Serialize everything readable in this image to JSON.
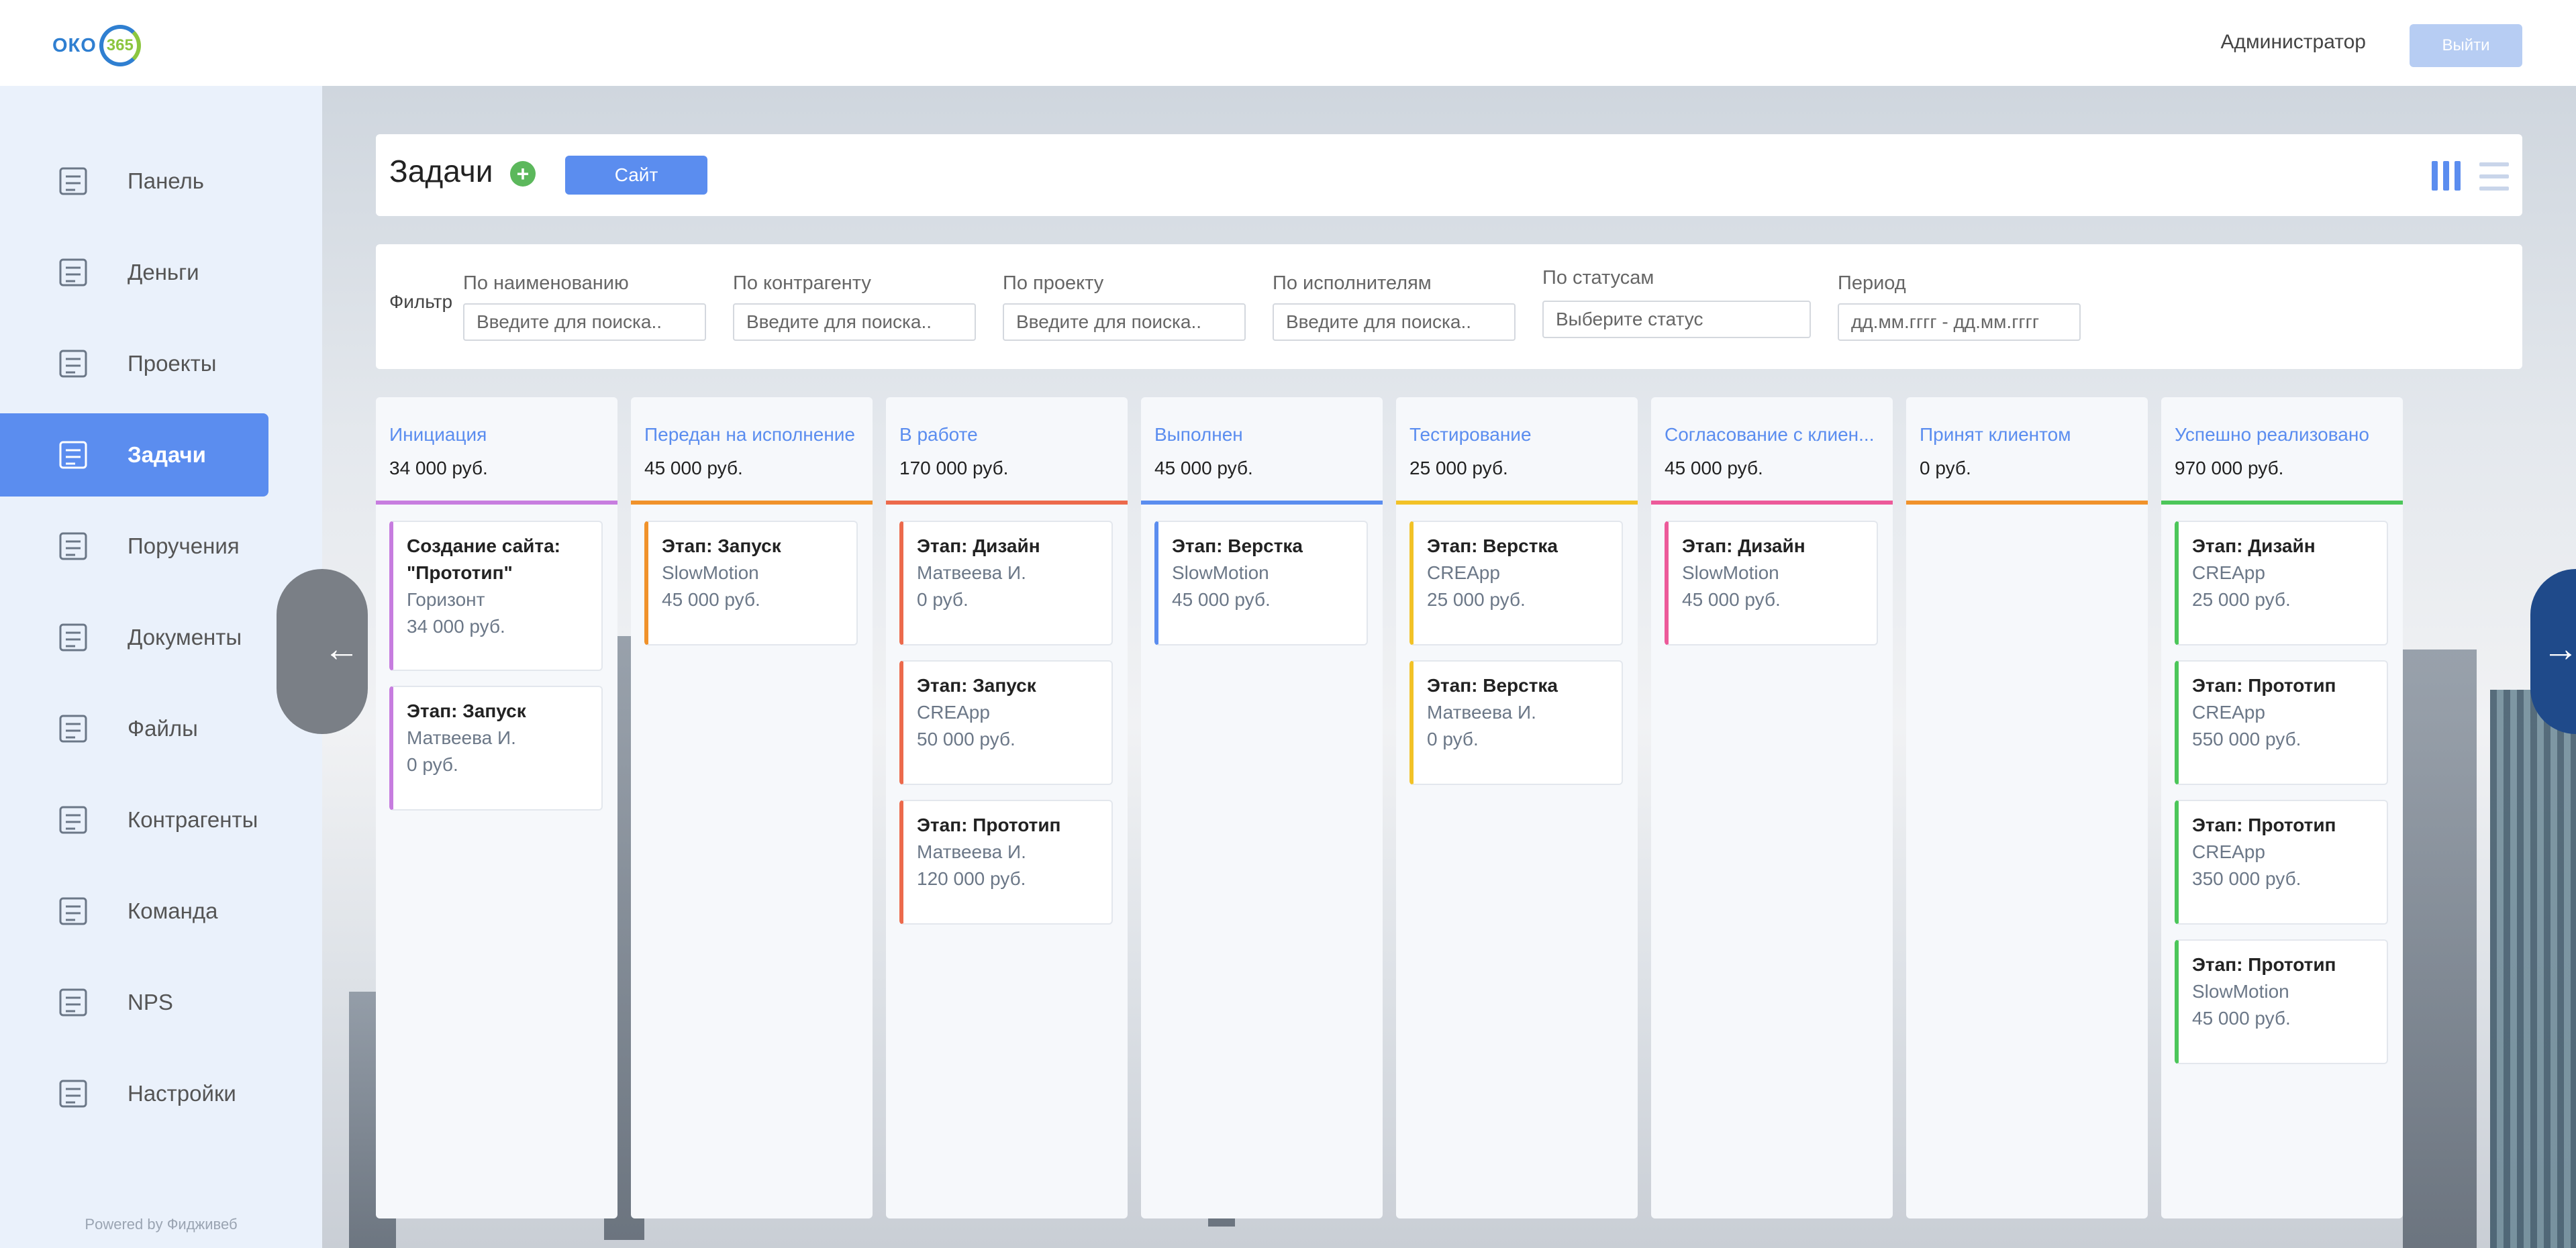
{
  "header": {
    "logo_text": "ОКО",
    "logo_number": "365",
    "user": "Администратор",
    "logout_label": "Выйти"
  },
  "sidebar": {
    "items": [
      {
        "label": "Панель",
        "icon": "dashboard-icon"
      },
      {
        "label": "Деньги",
        "icon": "money-icon"
      },
      {
        "label": "Проекты",
        "icon": "projects-icon"
      },
      {
        "label": "Задачи",
        "icon": "tasks-icon",
        "active": true
      },
      {
        "label": "Поручения",
        "icon": "assignments-icon"
      },
      {
        "label": "Документы",
        "icon": "documents-icon"
      },
      {
        "label": "Файлы",
        "icon": "files-icon"
      },
      {
        "label": "Контрагенты",
        "icon": "handshake-icon"
      },
      {
        "label": "Команда",
        "icon": "team-icon"
      },
      {
        "label": "NPS",
        "icon": "nps-icon"
      },
      {
        "label": "Настройки",
        "icon": "settings-icon"
      }
    ],
    "powered_by": "Powered by Фидживеб"
  },
  "page": {
    "title": "Задачи",
    "site_button": "Сайт"
  },
  "filter": {
    "label": "Фильтр",
    "fields": [
      {
        "caption": "По наименованию",
        "placeholder": "Введите для поиска.."
      },
      {
        "caption": "По контрагенту",
        "placeholder": "Введите для поиска.."
      },
      {
        "caption": "По проекту",
        "placeholder": "Введите для поиска.."
      },
      {
        "caption": "По исполнителям",
        "placeholder": "Введите для поиска.."
      },
      {
        "caption": "По статусам",
        "placeholder": "Выберите статус"
      },
      {
        "caption": "Период",
        "placeholder": "дд.мм.гггг - дд.мм.гггг"
      }
    ]
  },
  "columns": [
    {
      "title": "Инициация",
      "sum": "34 000 руб.",
      "color": "#c77ddf",
      "tasks": [
        {
          "title": "Создание сайта: \"Прототип\"",
          "client": "Горизонт",
          "amount": "34 000 руб."
        },
        {
          "title": "Этап: Запуск",
          "client": "Матвеева И.",
          "amount": "0 руб."
        }
      ]
    },
    {
      "title": "Передан на исполнение",
      "sum": "45 000 руб.",
      "color": "#f0922b",
      "tasks": [
        {
          "title": "Этап: Запуск",
          "client": "SlowMotion",
          "amount": "45 000 руб."
        }
      ]
    },
    {
      "title": "В работе",
      "sum": "170 000 руб.",
      "color": "#ec6a4c",
      "tasks": [
        {
          "title": "Этап: Дизайн",
          "client": "Матвеева И.",
          "amount": "0 руб."
        },
        {
          "title": "Этап: Запуск",
          "client": "CREApp",
          "amount": "50 000 руб."
        },
        {
          "title": "Этап: Прототип",
          "client": "Матвеева И.",
          "amount": "120 000 руб."
        }
      ]
    },
    {
      "title": "Выполнен",
      "sum": "45 000 руб.",
      "color": "#5b8def",
      "tasks": [
        {
          "title": "Этап: Верстка",
          "client": "SlowMotion",
          "amount": "45 000 руб."
        }
      ]
    },
    {
      "title": "Тестирование",
      "sum": "25 000 руб.",
      "color": "#f2c227",
      "tasks": [
        {
          "title": "Этап: Верстка",
          "client": "CREApp",
          "amount": "25 000 руб."
        },
        {
          "title": "Этап: Верстка",
          "client": "Матвеева И.",
          "amount": "0 руб."
        }
      ]
    },
    {
      "title": "Согласование с клиен...",
      "sum": "45 000 руб.",
      "color": "#ec5a9a",
      "tasks": [
        {
          "title": "Этап: Дизайн",
          "client": "SlowMotion",
          "amount": "45 000 руб."
        }
      ]
    },
    {
      "title": "Принят клиентом",
      "sum": "0 руб.",
      "color": "#f0922b",
      "tasks": []
    },
    {
      "title": "Успешно реализовано",
      "sum": "970 000 руб.",
      "color": "#4cc65a",
      "tasks": [
        {
          "title": "Этап: Дизайн",
          "client": "CREApp",
          "amount": "25 000 руб."
        },
        {
          "title": "Этап: Прототип",
          "client": "CREApp",
          "amount": "550 000 руб."
        },
        {
          "title": "Этап: Прототип",
          "client": "CREApp",
          "amount": "350 000 руб."
        },
        {
          "title": "Этап: Прототип",
          "client": "SlowMotion",
          "amount": "45 000 руб."
        }
      ]
    }
  ],
  "arrows": {
    "left": "←",
    "right": "→"
  }
}
